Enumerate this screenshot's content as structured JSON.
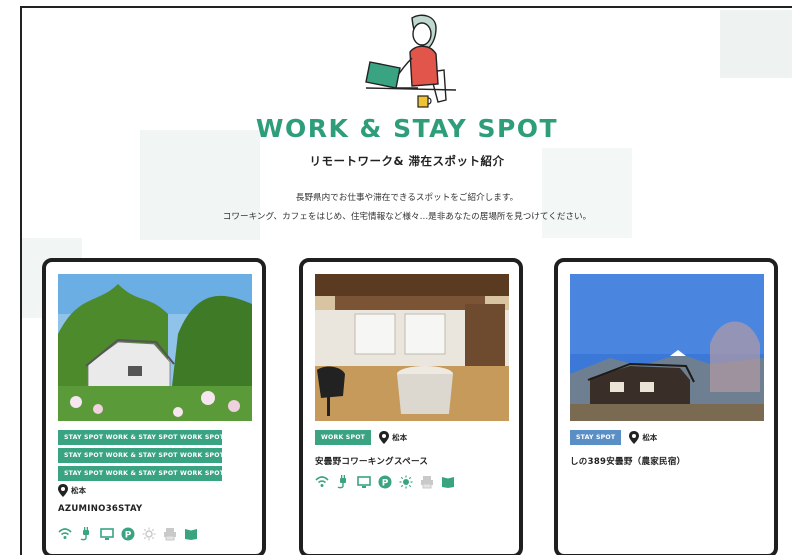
{
  "header": {
    "title": "WORK & STAY SPOT",
    "subtitle": "リモートワーク&  滞在スポット紹介",
    "description_line1": "長野県内でお仕事や滞在できるスポットをご紹介します。",
    "description_line2": "コワーキング、カフェをはじめ、住宅情報など様々…是非あなたの居場所を見つけてください。"
  },
  "colors": {
    "accent_green": "#3aa382",
    "title_green": "#2e9e7a",
    "tag_blue": "#5a8fc6"
  },
  "cards": [
    {
      "tags": [
        "STAY SPOT WORK & STAY SPOT WORK SPOT",
        "STAY SPOT WORK & STAY SPOT WORK SPOT",
        "STAY SPOT WORK & STAY SPOT WORK SPOT"
      ],
      "location": "松本",
      "name": "AZUMINO36STAY",
      "amenity_icons": [
        "wifi-icon",
        "power-plug-icon",
        "monitor-icon",
        "parking-icon",
        "sun-icon",
        "printer-icon",
        "book-icon"
      ]
    },
    {
      "tag": "WORK SPOT",
      "location": "松本",
      "name": "安曇野コワーキングスペース",
      "amenity_icons": [
        "wifi-icon",
        "power-plug-icon",
        "monitor-icon",
        "parking-icon",
        "sun-icon",
        "printer-icon",
        "book-icon"
      ]
    },
    {
      "tag": "STAY SPOT",
      "location": "松本",
      "name": "しの389安曇野（農家民宿）"
    }
  ]
}
